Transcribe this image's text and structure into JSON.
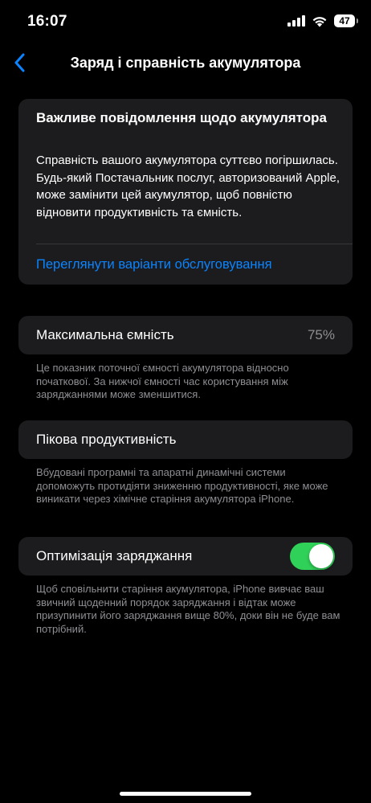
{
  "status_bar": {
    "time": "16:07",
    "battery_level": "47",
    "icons": [
      "cellular-signal-icon",
      "wifi-icon",
      "battery-icon"
    ]
  },
  "nav": {
    "title": "Заряд і справність акумулятора",
    "back_icon": "chevron-left-icon"
  },
  "notice": {
    "title": "Важливе повідомлення щодо акумулятора",
    "body": "Справність вашого акумулятора суттєво погіршилась. Будь-який Постачальник послуг, авторизований Apple, може замінити цей акумулятор, щоб повністю відновити продуктивність та ємність.",
    "link": "Переглянути варіанти обслуговування"
  },
  "capacity": {
    "label": "Максимальна ємність",
    "value": "75%",
    "note": "Це показник поточної ємності акумулятора відносно початкової. За нижчої ємності час користування між заряджаннями може зменшитися."
  },
  "peak": {
    "label": "Пікова продуктивність",
    "note": "Вбудовані програмні та апаратні динамічні системи допоможуть протидіяти зниженню продуктивності, яке може виникати через хімічне старіння акумулятора iPhone."
  },
  "optimize": {
    "label": "Оптимізація заряджання",
    "enabled": true,
    "note": "Щоб сповільнити старіння акумулятора, iPhone вивчає ваш звичний щоденний порядок заряджання і відтак може призупинити його заряджання вище 80%, доки він не буде вам потрібний."
  },
  "colors": {
    "accent": "#0a84ff",
    "toggle_on": "#30d158",
    "card_bg": "#1c1c1e",
    "secondary_text": "#8e8e93"
  }
}
